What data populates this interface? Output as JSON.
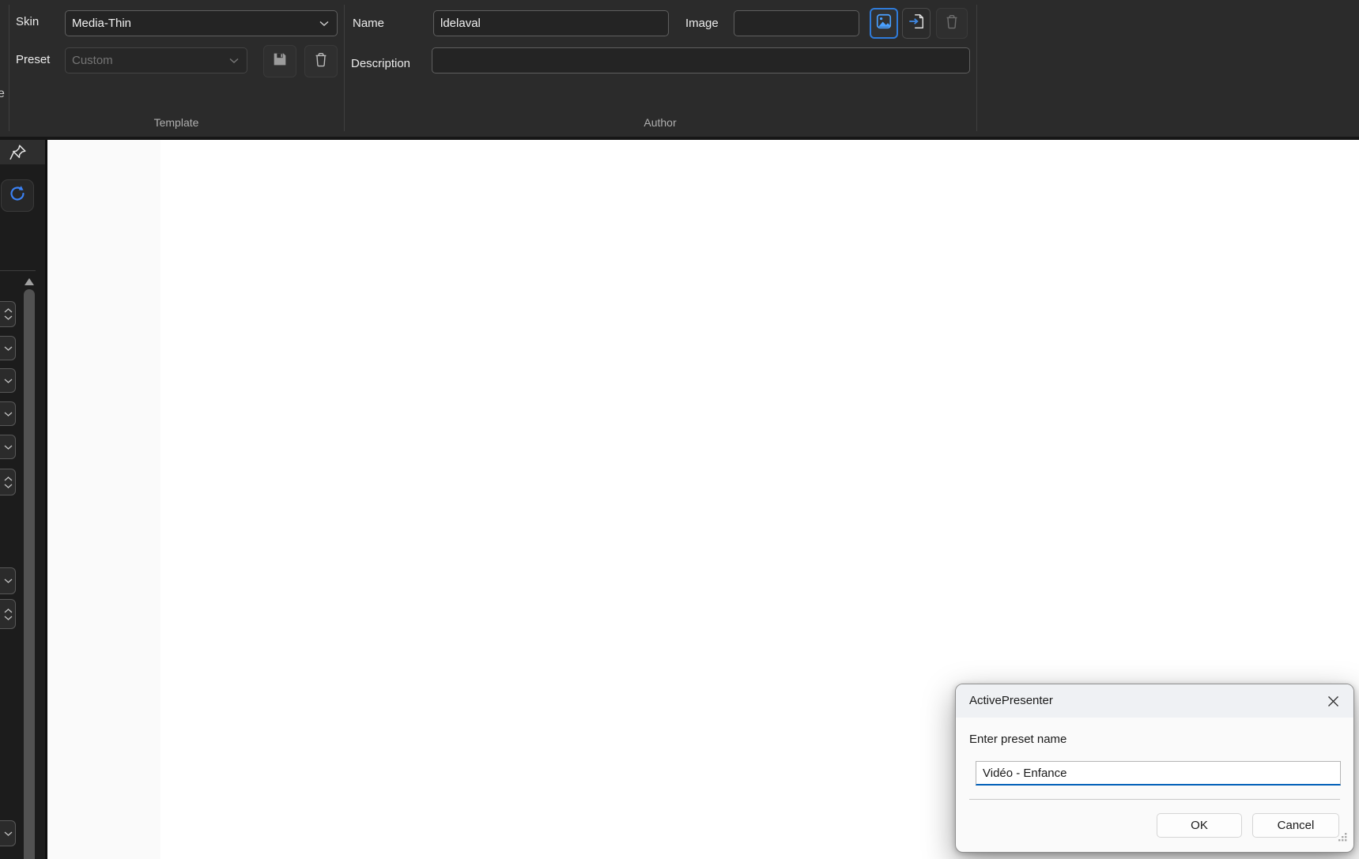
{
  "window": {
    "edge_fragment": "e"
  },
  "ribbon": {
    "template_group": {
      "caption": "Template",
      "skin_label": "Skin",
      "skin_value": "Media-Thin",
      "preset_label": "Preset",
      "preset_value": "Custom"
    },
    "author_group": {
      "caption": "Author",
      "name_label": "Name",
      "name_value": "ldelaval",
      "image_label": "Image",
      "image_value": "",
      "description_label": "Description",
      "description_value": ""
    }
  },
  "dialog": {
    "title": "ActivePresenter",
    "prompt": "Enter preset name",
    "input_value": "Vidéo - Enfance",
    "ok_label": "OK",
    "cancel_label": "Cancel"
  },
  "icons": {
    "skin_dropdown": "chevron-down",
    "preset_dropdown": "chevron-down",
    "save_preset": "floppy-disk",
    "delete_preset": "trash-can",
    "pick_image": "picture-image",
    "import_image": "file-import-arrow",
    "delete_image": "trash-can",
    "pin": "pushpin",
    "refresh": "circular-arrow",
    "scroll_up": "triangle-up",
    "dialog_close": "x-mark",
    "resize_grip": "diagonal-grip-dots"
  },
  "colors": {
    "ribbon_bg": "#2b2b2b",
    "sidebar_bg": "#1c1c1c",
    "canvas_bg": "#ffffff",
    "panel_column_bg": "#fafafa",
    "accent_blue": "#3b82f6",
    "dialog_titlebar": "#eff1f4",
    "dialog_body": "#fafafa",
    "focus_underline": "#005fb8"
  }
}
